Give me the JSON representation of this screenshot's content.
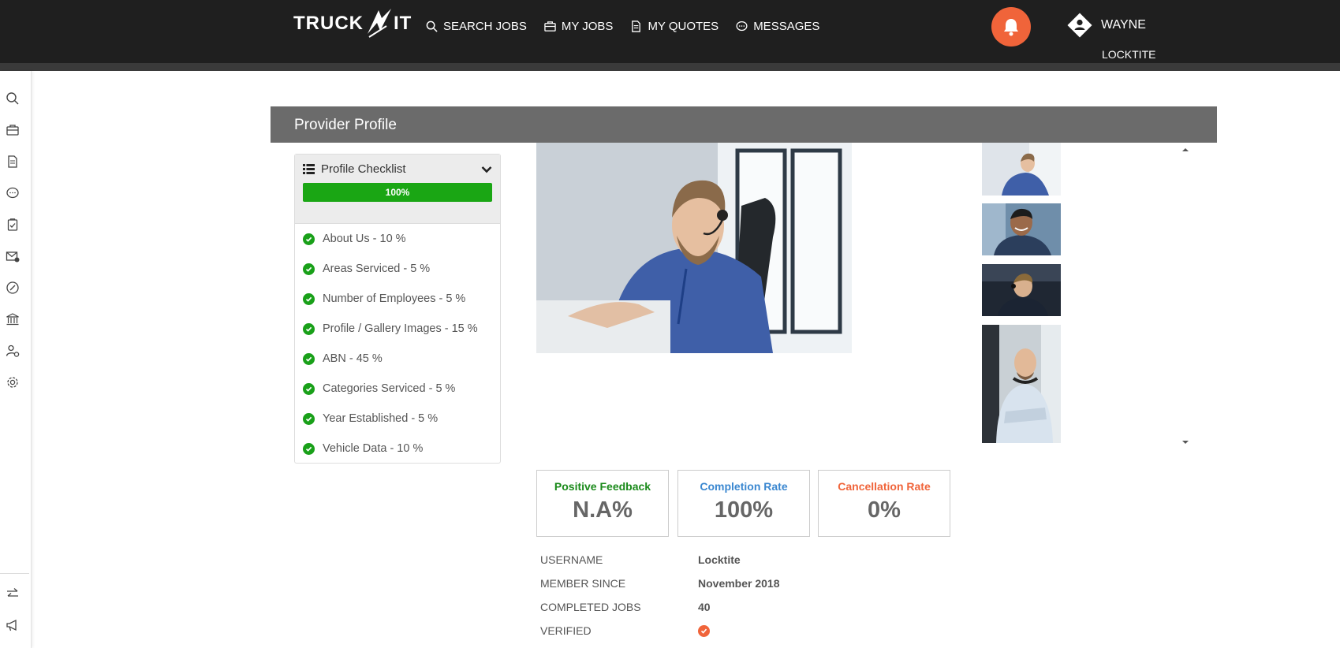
{
  "brand": {
    "left": "TRUCK",
    "right": "IT"
  },
  "nav": [
    {
      "label": "SEARCH JOBS",
      "icon": "search-icon"
    },
    {
      "label": "MY JOBS",
      "icon": "briefcase-icon"
    },
    {
      "label": "MY QUOTES",
      "icon": "document-icon"
    },
    {
      "label": "MESSAGES",
      "icon": "chat-icon"
    }
  ],
  "user": {
    "name": "WAYNE",
    "company": "LOCKTITE"
  },
  "colors": {
    "accent": "#f0643a",
    "green": "#1aa614",
    "blue": "#3a87d0",
    "header_bg": "#1f1f1f",
    "section_bg": "#6b6b6b"
  },
  "section": {
    "title": "Provider Profile"
  },
  "checklist": {
    "title": "Profile Checklist",
    "progress_label": "100%",
    "progress": 1.0,
    "items": [
      {
        "label": "About Us - 10 %"
      },
      {
        "label": "Areas Serviced - 5 %"
      },
      {
        "label": "Number of Employees - 5 %"
      },
      {
        "label": "Profile / Gallery Images - 15 %"
      },
      {
        "label": "ABN - 45 %"
      },
      {
        "label": "Categories Serviced - 5 %"
      },
      {
        "label": "Year Established - 5 %"
      },
      {
        "label": "Vehicle Data - 10 %"
      }
    ]
  },
  "stats": {
    "positive": {
      "label": "Positive Feedback",
      "value": "N.A%",
      "color": "#1a8a1a"
    },
    "completion": {
      "label": "Completion Rate",
      "value": "100%",
      "color": "#3a87d0"
    },
    "cancellation": {
      "label": "Cancellation Rate",
      "value": "0%",
      "color": "#f0643a"
    }
  },
  "details": {
    "username": {
      "key": "USERNAME",
      "value": "Locktite"
    },
    "member_since": {
      "key": "MEMBER SINCE",
      "value": "November 2018"
    },
    "completed_jobs": {
      "key": "COMPLETED JOBS",
      "value": "40"
    },
    "verified": {
      "key": "VERIFIED"
    }
  }
}
